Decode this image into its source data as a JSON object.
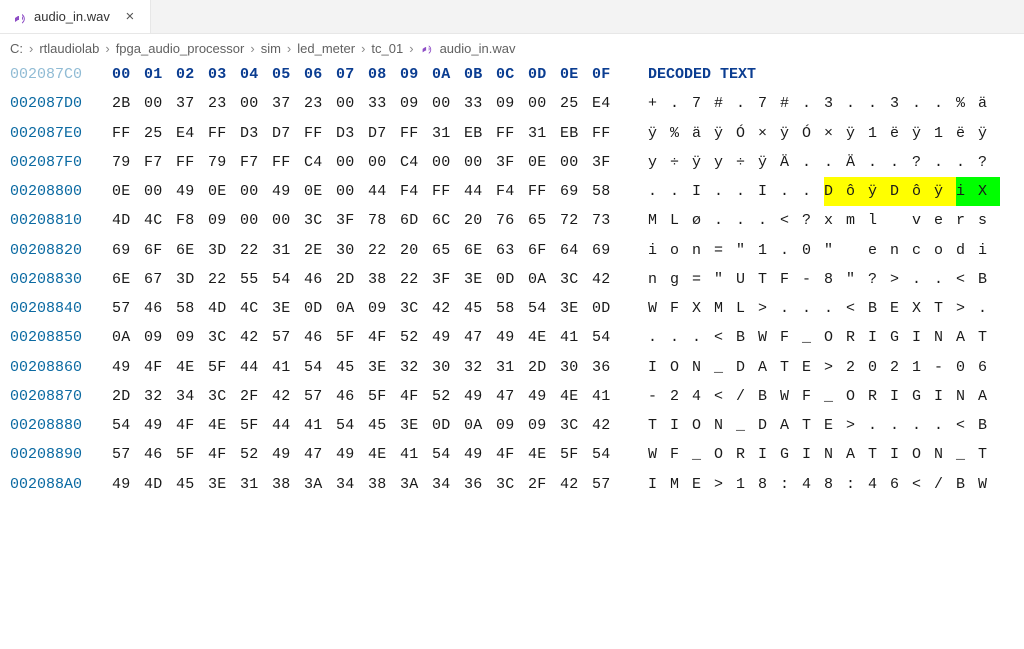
{
  "tab": {
    "label": "audio_in.wav",
    "icon": "audio-file-icon"
  },
  "breadcrumbs": [
    "C:",
    "rtlaudiolab",
    "fpga_audio_processor",
    "sim",
    "led_meter",
    "tc_01",
    "audio_in.wav"
  ],
  "header": {
    "faded_offset": "002087C0",
    "byte_cols": [
      "00",
      "01",
      "02",
      "03",
      "04",
      "05",
      "06",
      "07",
      "08",
      "09",
      "0A",
      "0B",
      "0C",
      "0D",
      "0E",
      "0F"
    ],
    "decoded_label": "DECODED TEXT"
  },
  "rows": [
    {
      "offset": "002087D0",
      "bytes": [
        "2B",
        "00",
        "37",
        "23",
        "00",
        "37",
        "23",
        "00",
        "33",
        "09",
        "00",
        "33",
        "09",
        "00",
        "25",
        "E4"
      ],
      "decoded": [
        {
          "c": "+"
        },
        {
          "c": "."
        },
        {
          "c": "7"
        },
        {
          "c": "#"
        },
        {
          "c": "."
        },
        {
          "c": "7"
        },
        {
          "c": "#"
        },
        {
          "c": "."
        },
        {
          "c": "3"
        },
        {
          "c": "."
        },
        {
          "c": "."
        },
        {
          "c": "3"
        },
        {
          "c": "."
        },
        {
          "c": "."
        },
        {
          "c": "%"
        },
        {
          "c": "ä"
        }
      ]
    },
    {
      "offset": "002087E0",
      "bytes": [
        "FF",
        "25",
        "E4",
        "FF",
        "D3",
        "D7",
        "FF",
        "D3",
        "D7",
        "FF",
        "31",
        "EB",
        "FF",
        "31",
        "EB",
        "FF"
      ],
      "decoded": [
        {
          "c": "ÿ"
        },
        {
          "c": "%"
        },
        {
          "c": "ä"
        },
        {
          "c": "ÿ"
        },
        {
          "c": "Ó"
        },
        {
          "c": "×"
        },
        {
          "c": "ÿ"
        },
        {
          "c": "Ó"
        },
        {
          "c": "×"
        },
        {
          "c": "ÿ"
        },
        {
          "c": "1"
        },
        {
          "c": "ë"
        },
        {
          "c": "ÿ"
        },
        {
          "c": "1"
        },
        {
          "c": "ë"
        },
        {
          "c": "ÿ"
        }
      ]
    },
    {
      "offset": "002087F0",
      "bytes": [
        "79",
        "F7",
        "FF",
        "79",
        "F7",
        "FF",
        "C4",
        "00",
        "00",
        "C4",
        "00",
        "00",
        "3F",
        "0E",
        "00",
        "3F"
      ],
      "decoded": [
        {
          "c": "y"
        },
        {
          "c": "÷"
        },
        {
          "c": "ÿ"
        },
        {
          "c": "y"
        },
        {
          "c": "÷"
        },
        {
          "c": "ÿ"
        },
        {
          "c": "Ä"
        },
        {
          "c": "."
        },
        {
          "c": "."
        },
        {
          "c": "Ä"
        },
        {
          "c": "."
        },
        {
          "c": "."
        },
        {
          "c": "?"
        },
        {
          "c": "."
        },
        {
          "c": "."
        },
        {
          "c": "?"
        }
      ]
    },
    {
      "offset": "00208800",
      "bytes": [
        "0E",
        "00",
        "49",
        "0E",
        "00",
        "49",
        "0E",
        "00",
        "44",
        "F4",
        "FF",
        "44",
        "F4",
        "FF",
        "69",
        "58"
      ],
      "decoded": [
        {
          "c": "."
        },
        {
          "c": "."
        },
        {
          "c": "I"
        },
        {
          "c": "."
        },
        {
          "c": "."
        },
        {
          "c": "I"
        },
        {
          "c": "."
        },
        {
          "c": "."
        },
        {
          "c": "D",
          "hl": "y"
        },
        {
          "c": "ô",
          "hl": "y"
        },
        {
          "c": "ÿ",
          "hl": "y"
        },
        {
          "c": "D",
          "hl": "y"
        },
        {
          "c": "ô",
          "hl": "y"
        },
        {
          "c": "ÿ",
          "hl": "y"
        },
        {
          "c": "i",
          "hl": "g"
        },
        {
          "c": "X",
          "hl": "g"
        }
      ]
    },
    {
      "offset": "00208810",
      "bytes": [
        "4D",
        "4C",
        "F8",
        "09",
        "00",
        "00",
        "3C",
        "3F",
        "78",
        "6D",
        "6C",
        "20",
        "76",
        "65",
        "72",
        "73"
      ],
      "decoded": [
        {
          "c": "M"
        },
        {
          "c": "L"
        },
        {
          "c": "ø"
        },
        {
          "c": "."
        },
        {
          "c": "."
        },
        {
          "c": "."
        },
        {
          "c": "<"
        },
        {
          "c": "?"
        },
        {
          "c": "x"
        },
        {
          "c": "m"
        },
        {
          "c": "l"
        },
        {
          "c": " "
        },
        {
          "c": "v"
        },
        {
          "c": "e"
        },
        {
          "c": "r"
        },
        {
          "c": "s"
        }
      ]
    },
    {
      "offset": "00208820",
      "bytes": [
        "69",
        "6F",
        "6E",
        "3D",
        "22",
        "31",
        "2E",
        "30",
        "22",
        "20",
        "65",
        "6E",
        "63",
        "6F",
        "64",
        "69"
      ],
      "decoded": [
        {
          "c": "i"
        },
        {
          "c": "o"
        },
        {
          "c": "n"
        },
        {
          "c": "="
        },
        {
          "c": "\""
        },
        {
          "c": "1"
        },
        {
          "c": "."
        },
        {
          "c": "0"
        },
        {
          "c": "\""
        },
        {
          "c": " "
        },
        {
          "c": "e"
        },
        {
          "c": "n"
        },
        {
          "c": "c"
        },
        {
          "c": "o"
        },
        {
          "c": "d"
        },
        {
          "c": "i"
        }
      ]
    },
    {
      "offset": "00208830",
      "bytes": [
        "6E",
        "67",
        "3D",
        "22",
        "55",
        "54",
        "46",
        "2D",
        "38",
        "22",
        "3F",
        "3E",
        "0D",
        "0A",
        "3C",
        "42"
      ],
      "decoded": [
        {
          "c": "n"
        },
        {
          "c": "g"
        },
        {
          "c": "="
        },
        {
          "c": "\""
        },
        {
          "c": "U"
        },
        {
          "c": "T"
        },
        {
          "c": "F"
        },
        {
          "c": "-"
        },
        {
          "c": "8"
        },
        {
          "c": "\""
        },
        {
          "c": "?"
        },
        {
          "c": ">"
        },
        {
          "c": "."
        },
        {
          "c": "."
        },
        {
          "c": "<"
        },
        {
          "c": "B"
        }
      ]
    },
    {
      "offset": "00208840",
      "bytes": [
        "57",
        "46",
        "58",
        "4D",
        "4C",
        "3E",
        "0D",
        "0A",
        "09",
        "3C",
        "42",
        "45",
        "58",
        "54",
        "3E",
        "0D"
      ],
      "decoded": [
        {
          "c": "W"
        },
        {
          "c": "F"
        },
        {
          "c": "X"
        },
        {
          "c": "M"
        },
        {
          "c": "L"
        },
        {
          "c": ">"
        },
        {
          "c": "."
        },
        {
          "c": "."
        },
        {
          "c": "."
        },
        {
          "c": "<"
        },
        {
          "c": "B"
        },
        {
          "c": "E"
        },
        {
          "c": "X"
        },
        {
          "c": "T"
        },
        {
          "c": ">"
        },
        {
          "c": "."
        }
      ]
    },
    {
      "offset": "00208850",
      "bytes": [
        "0A",
        "09",
        "09",
        "3C",
        "42",
        "57",
        "46",
        "5F",
        "4F",
        "52",
        "49",
        "47",
        "49",
        "4E",
        "41",
        "54"
      ],
      "decoded": [
        {
          "c": "."
        },
        {
          "c": "."
        },
        {
          "c": "."
        },
        {
          "c": "<"
        },
        {
          "c": "B"
        },
        {
          "c": "W"
        },
        {
          "c": "F"
        },
        {
          "c": "_"
        },
        {
          "c": "O"
        },
        {
          "c": "R"
        },
        {
          "c": "I"
        },
        {
          "c": "G"
        },
        {
          "c": "I"
        },
        {
          "c": "N"
        },
        {
          "c": "A"
        },
        {
          "c": "T"
        }
      ]
    },
    {
      "offset": "00208860",
      "bytes": [
        "49",
        "4F",
        "4E",
        "5F",
        "44",
        "41",
        "54",
        "45",
        "3E",
        "32",
        "30",
        "32",
        "31",
        "2D",
        "30",
        "36"
      ],
      "decoded": [
        {
          "c": "I"
        },
        {
          "c": "O"
        },
        {
          "c": "N"
        },
        {
          "c": "_"
        },
        {
          "c": "D"
        },
        {
          "c": "A"
        },
        {
          "c": "T"
        },
        {
          "c": "E"
        },
        {
          "c": ">"
        },
        {
          "c": "2"
        },
        {
          "c": "0"
        },
        {
          "c": "2"
        },
        {
          "c": "1"
        },
        {
          "c": "-"
        },
        {
          "c": "0"
        },
        {
          "c": "6"
        }
      ]
    },
    {
      "offset": "00208870",
      "bytes": [
        "2D",
        "32",
        "34",
        "3C",
        "2F",
        "42",
        "57",
        "46",
        "5F",
        "4F",
        "52",
        "49",
        "47",
        "49",
        "4E",
        "41"
      ],
      "decoded": [
        {
          "c": "-"
        },
        {
          "c": "2"
        },
        {
          "c": "4"
        },
        {
          "c": "<"
        },
        {
          "c": "/"
        },
        {
          "c": "B"
        },
        {
          "c": "W"
        },
        {
          "c": "F"
        },
        {
          "c": "_"
        },
        {
          "c": "O"
        },
        {
          "c": "R"
        },
        {
          "c": "I"
        },
        {
          "c": "G"
        },
        {
          "c": "I"
        },
        {
          "c": "N"
        },
        {
          "c": "A"
        }
      ]
    },
    {
      "offset": "00208880",
      "bytes": [
        "54",
        "49",
        "4F",
        "4E",
        "5F",
        "44",
        "41",
        "54",
        "45",
        "3E",
        "0D",
        "0A",
        "09",
        "09",
        "3C",
        "42"
      ],
      "decoded": [
        {
          "c": "T"
        },
        {
          "c": "I"
        },
        {
          "c": "O"
        },
        {
          "c": "N"
        },
        {
          "c": "_"
        },
        {
          "c": "D"
        },
        {
          "c": "A"
        },
        {
          "c": "T"
        },
        {
          "c": "E"
        },
        {
          "c": ">"
        },
        {
          "c": "."
        },
        {
          "c": "."
        },
        {
          "c": "."
        },
        {
          "c": "."
        },
        {
          "c": "<"
        },
        {
          "c": "B"
        }
      ]
    },
    {
      "offset": "00208890",
      "bytes": [
        "57",
        "46",
        "5F",
        "4F",
        "52",
        "49",
        "47",
        "49",
        "4E",
        "41",
        "54",
        "49",
        "4F",
        "4E",
        "5F",
        "54"
      ],
      "decoded": [
        {
          "c": "W"
        },
        {
          "c": "F"
        },
        {
          "c": "_"
        },
        {
          "c": "O"
        },
        {
          "c": "R"
        },
        {
          "c": "I"
        },
        {
          "c": "G"
        },
        {
          "c": "I"
        },
        {
          "c": "N"
        },
        {
          "c": "A"
        },
        {
          "c": "T"
        },
        {
          "c": "I"
        },
        {
          "c": "O"
        },
        {
          "c": "N"
        },
        {
          "c": "_"
        },
        {
          "c": "T"
        }
      ]
    },
    {
      "offset": "002088A0",
      "bytes": [
        "49",
        "4D",
        "45",
        "3E",
        "31",
        "38",
        "3A",
        "34",
        "38",
        "3A",
        "34",
        "36",
        "3C",
        "2F",
        "42",
        "57"
      ],
      "decoded": [
        {
          "c": "I"
        },
        {
          "c": "M"
        },
        {
          "c": "E"
        },
        {
          "c": ">"
        },
        {
          "c": "1"
        },
        {
          "c": "8"
        },
        {
          "c": ":"
        },
        {
          "c": "4"
        },
        {
          "c": "8"
        },
        {
          "c": ":"
        },
        {
          "c": "4"
        },
        {
          "c": "6"
        },
        {
          "c": "<"
        },
        {
          "c": "/"
        },
        {
          "c": "B"
        },
        {
          "c": "W"
        }
      ]
    }
  ]
}
